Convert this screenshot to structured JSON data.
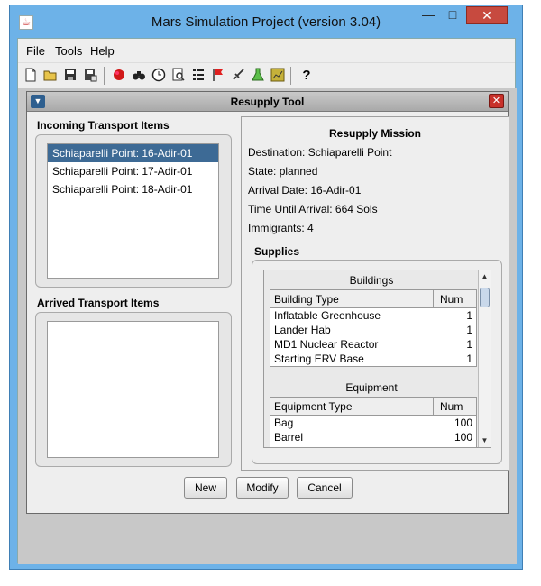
{
  "window": {
    "title": "Mars Simulation Project (version 3.04)",
    "minimize": "—",
    "maximize": "□",
    "close": "✕"
  },
  "menubar": {
    "file": "File",
    "tools": "Tools",
    "help": "Help"
  },
  "toolbar": {
    "icons": [
      "new-file-icon",
      "open-folder-icon",
      "save-icon",
      "save-as-icon",
      "mars-icon",
      "binoculars-icon",
      "clock-icon",
      "search-icon",
      "settings-list-icon",
      "flag-icon",
      "rocket-icon",
      "science-flask-icon",
      "chart-icon",
      "help-icon"
    ],
    "help_glyph": "?"
  },
  "resupply_tool": {
    "title": "Resupply Tool",
    "incoming_title": "Incoming Transport Items",
    "incoming_items": [
      "Schiaparelli Point: 16-Adir-01",
      "Schiaparelli Point: 17-Adir-01",
      "Schiaparelli Point: 18-Adir-01"
    ],
    "selected_index": 0,
    "arrived_title": "Arrived Transport Items",
    "arrived_items": [],
    "mission": {
      "title": "Resupply Mission",
      "destination": "Destination: Schiaparelli Point",
      "state": "State: planned",
      "arrival_date": "Arrival Date: 16-Adir-01",
      "time_until_arrival": "Time Until Arrival: 664 Sols",
      "immigrants": "Immigrants: 4"
    },
    "supplies_title": "Supplies",
    "buildings": {
      "title": "Buildings",
      "col_type": "Building Type",
      "col_num": "Num",
      "rows": [
        {
          "type": "Inflatable Greenhouse",
          "num": "1"
        },
        {
          "type": "Lander Hab",
          "num": "1"
        },
        {
          "type": "MD1 Nuclear Reactor",
          "num": "1"
        },
        {
          "type": "Starting ERV Base",
          "num": "1"
        }
      ]
    },
    "equipment": {
      "title": "Equipment",
      "col_type": "Equipment Type",
      "col_num": "Num",
      "rows": [
        {
          "type": "Bag",
          "num": "100"
        },
        {
          "type": "Barrel",
          "num": "100"
        }
      ]
    },
    "buttons": {
      "new": "New",
      "modify": "Modify",
      "cancel": "Cancel"
    }
  }
}
